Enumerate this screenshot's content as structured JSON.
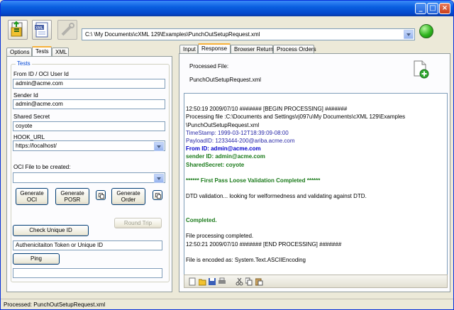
{
  "window": {
    "title": ""
  },
  "toolbar": {
    "path": "C:\\                                                                      \\My Documents\\cXML 129\\Examples\\PunchOutSetupRequest.xml"
  },
  "left_tabs": [
    {
      "label": "Options"
    },
    {
      "label": "Tests"
    },
    {
      "label": "XML"
    }
  ],
  "tests": {
    "group_title": "Tests",
    "from_id_label": "From ID / OCI User Id",
    "from_id_value": "admin@acme.com",
    "sender_id_label": "Sender Id",
    "sender_id_value": "admin@acme.com",
    "shared_secret_label": "Shared Secret",
    "shared_secret_value": "coyote",
    "hook_url_label": "HOOK_URL",
    "hook_url_value": "https://localhost/",
    "oci_file_label": "OCI File to be created:",
    "oci_file_value": "",
    "generate_oci": "Generate\nOCI",
    "generate_posr": "Generate\nPOSR",
    "generate_order": "Generate\nOrder",
    "round_trip": "Round Trip",
    "check_unique_id": "Check Unique ID",
    "auth_token_value": "Authenicitaiton Token or Unique ID",
    "ping": "Ping",
    "ping_result": ""
  },
  "right_tabs": [
    {
      "label": "Input"
    },
    {
      "label": "Response"
    },
    {
      "label": "Browser Return"
    },
    {
      "label": "Process Orders"
    }
  ],
  "response": {
    "processed_label": "Processed File:",
    "processed_file": "PunchOutSetupRequest.xml",
    "log": [
      {
        "text": "",
        "style": ""
      },
      {
        "text": "12:50:19 2009/07/10 ####### [BEGIN PROCESSING] #######",
        "style": ""
      },
      {
        "text": " Processing file :C:\\Documents and Settings\\rj097u\\My Documents\\cXML 129\\Examples",
        "style": ""
      },
      {
        "text": "\\PunchOutSetupRequest.xml",
        "style": ""
      },
      {
        "text": "TimeStamp: 1999-03-12T18:39:09-08:00",
        "style": "c-blue"
      },
      {
        "text": "PayloadID: 1233444-200@ariba.acme.com",
        "style": "c-blue"
      },
      {
        "text": "From ID: admin@acme.com",
        "style": "c-bold-blue"
      },
      {
        "text": "sender ID: admin@acme.com",
        "style": "c-green"
      },
      {
        "text": "SharedSecret: coyote",
        "style": "c-green"
      },
      {
        "text": "",
        "style": ""
      },
      {
        "text": " ******   First Pass Loose Validation Completed   ******",
        "style": "c-green"
      },
      {
        "text": "",
        "style": ""
      },
      {
        "text": "DTD validation... looking for welformedness and validating against DTD.",
        "style": ""
      },
      {
        "text": "",
        "style": ""
      },
      {
        "text": "",
        "style": ""
      },
      {
        "text": "Completed.",
        "style": "c-green"
      },
      {
        "text": "",
        "style": ""
      },
      {
        "text": "File processing completed.",
        "style": ""
      },
      {
        "text": "12:50:21 2009/07/10 ####### [END PROCESSING] #######",
        "style": ""
      },
      {
        "text": "",
        "style": ""
      },
      {
        "text": "File is encoded as: System.Text.ASCIIEncoding",
        "style": ""
      }
    ]
  },
  "statusbar": {
    "text": "Processed: PunchOutSetupRequest.xml"
  },
  "colors": {
    "title_bar": "#0a5fe0",
    "status_light": "#2fb51e",
    "tab_highlight": "#f7b13a"
  }
}
